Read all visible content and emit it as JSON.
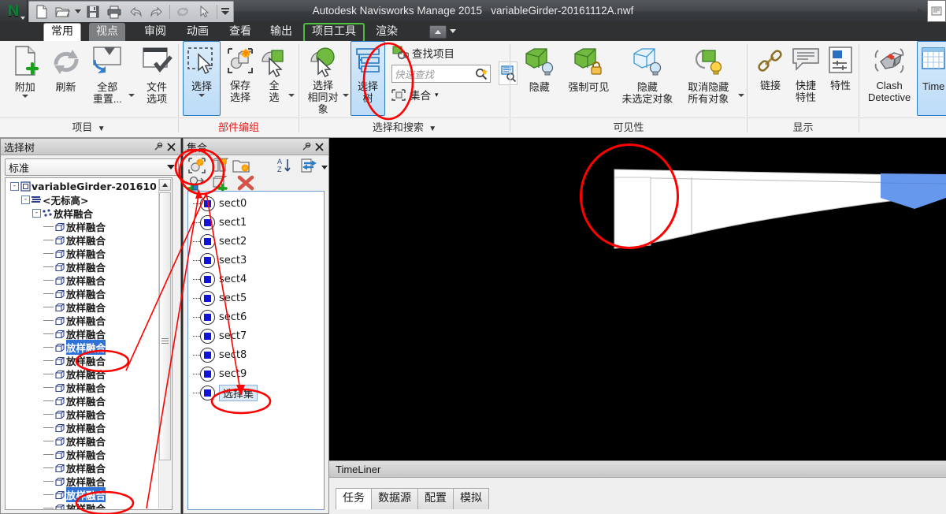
{
  "window": {
    "title_app": "Autodesk Navisworks Manage 2015",
    "title_file": "variableGirder-20161112A.nwf",
    "app_logo": "N"
  },
  "quick_access": [
    {
      "name": "new-file-icon",
      "label": "新建"
    },
    {
      "name": "open-file-icon",
      "label": "打开"
    },
    {
      "name": "open-dropdown-icon",
      "label": "▾"
    },
    {
      "name": "save-icon",
      "label": "保存"
    },
    {
      "name": "print-icon",
      "label": "打印"
    },
    {
      "name": "undo-icon",
      "label": "撤消"
    },
    {
      "name": "redo-icon",
      "label": "恢复"
    },
    {
      "name": "refresh-icon",
      "label": "刷新"
    },
    {
      "name": "select-cursor-icon",
      "label": "选择"
    },
    {
      "name": "qat-dropdown-icon",
      "label": "▾"
    }
  ],
  "tabs": [
    {
      "label": "常用",
      "state": "active"
    },
    {
      "label": "视点",
      "state": "hover"
    },
    {
      "label": "审阅",
      "state": "normal"
    },
    {
      "label": "动画",
      "state": "normal"
    },
    {
      "label": "查看",
      "state": "normal"
    },
    {
      "label": "输出",
      "state": "normal"
    },
    {
      "label": "项目工具",
      "state": "outlined"
    },
    {
      "label": "渲染",
      "state": "normal"
    }
  ],
  "ribbon": {
    "groups": [
      {
        "label": "项目",
        "label_color": "#333333",
        "buttons": [
          {
            "label": "附加",
            "icon": "attach-file-icon",
            "dropdown": true
          },
          {
            "label": "刷新",
            "icon": "refresh-icon",
            "dropdown": false
          },
          {
            "label": "全部\n重置...",
            "icon": "reset-all-icon",
            "dropdown": true
          },
          {
            "label": "文件\n选项",
            "icon": "file-options-icon",
            "dropdown": false
          }
        ]
      },
      {
        "label": "部件编组",
        "label_color": "#e11c1c",
        "buttons": [
          {
            "label": "选择",
            "icon": "select-marquee-icon",
            "dropdown": true,
            "selected": true
          },
          {
            "label": "保存\n选择",
            "icon": "save-selection-icon",
            "dropdown": false
          },
          {
            "label": "全\n选",
            "icon": "select-all-icon",
            "dropdown": true
          }
        ]
      },
      {
        "label": "选择和搜索",
        "label_color": "#333333",
        "buttons": [
          {
            "label": "选择\n相同对象",
            "icon": "select-same-icon",
            "dropdown": true
          },
          {
            "label": "选择\n树",
            "icon": "selection-tree-icon",
            "dropdown": false,
            "selected": true
          }
        ],
        "find_item_label": "查找项目",
        "find_item_icon": "find-item-icon",
        "quick_find_placeholder": "快速查找",
        "quick_find_icon": "search-icon",
        "sets_label": "集合",
        "sets_icon": "sets-icon",
        "sets_dropdown": "▾",
        "find_comments_icon": "find-comments-icon"
      },
      {
        "label": "可见性",
        "label_color": "#333333",
        "buttons": [
          {
            "label": "隐藏",
            "icon": "hide-icon",
            "dropdown": false
          },
          {
            "label": "强制可见",
            "icon": "require-visible-icon",
            "dropdown": false
          },
          {
            "label": "隐藏\n未选定对象",
            "icon": "hide-unselected-icon",
            "dropdown": false
          },
          {
            "label": "取消隐藏\n所有对象",
            "icon": "unhide-all-icon",
            "dropdown": true
          }
        ]
      },
      {
        "label": "显示",
        "label_color": "#333333",
        "buttons": [
          {
            "label": "链接",
            "icon": "links-icon",
            "dropdown": false
          },
          {
            "label": "快捷\n特性",
            "icon": "quick-properties-icon",
            "dropdown": false
          },
          {
            "label": "特性",
            "icon": "properties-icon",
            "dropdown": false
          }
        ]
      },
      {
        "label": "",
        "label_color": "#333333",
        "buttons": [
          {
            "label": "Clash\nDetective",
            "icon": "clash-detective-icon",
            "dropdown": false
          },
          {
            "label": "Time",
            "icon": "timeliner-icon",
            "dropdown": false,
            "selected": true
          }
        ]
      }
    ]
  },
  "selection_tree": {
    "title": "选择树",
    "pin_icon": "pin-icon",
    "close_icon": "close-icon",
    "dropdown_value": "标准",
    "dropdown_icon": "chevron-down-icon",
    "nodes": [
      {
        "label": "variableGirder-201610",
        "depth": 0,
        "icon": "file-node-icon",
        "expander": "-",
        "bold": true,
        "selected": false
      },
      {
        "label": "<无标高>",
        "depth": 1,
        "icon": "level-node-icon",
        "expander": "-",
        "bold": true,
        "selected": false
      },
      {
        "label": "放样融合",
        "depth": 2,
        "icon": "group-node-icon",
        "expander": "-",
        "bold": true,
        "selected": false
      },
      {
        "label": "放样融合",
        "depth": 3,
        "icon": "geometry-node-icon",
        "expander": "",
        "bold": true,
        "selected": false
      },
      {
        "label": "放样融合",
        "depth": 3,
        "icon": "geometry-node-icon",
        "expander": "",
        "bold": true,
        "selected": false
      },
      {
        "label": "放样融合",
        "depth": 3,
        "icon": "geometry-node-icon",
        "expander": "",
        "bold": true,
        "selected": false
      },
      {
        "label": "放样融合",
        "depth": 3,
        "icon": "geometry-node-icon",
        "expander": "",
        "bold": true,
        "selected": false
      },
      {
        "label": "放样融合",
        "depth": 3,
        "icon": "geometry-node-icon",
        "expander": "",
        "bold": true,
        "selected": false
      },
      {
        "label": "放样融合",
        "depth": 3,
        "icon": "geometry-node-icon",
        "expander": "",
        "bold": true,
        "selected": false
      },
      {
        "label": "放样融合",
        "depth": 3,
        "icon": "geometry-node-icon",
        "expander": "",
        "bold": true,
        "selected": false
      },
      {
        "label": "放样融合",
        "depth": 3,
        "icon": "geometry-node-icon",
        "expander": "",
        "bold": true,
        "selected": false
      },
      {
        "label": "放样融合",
        "depth": 3,
        "icon": "geometry-node-icon",
        "expander": "",
        "bold": true,
        "selected": false
      },
      {
        "label": "放样融合",
        "depth": 3,
        "icon": "geometry-node-icon",
        "expander": "",
        "bold": true,
        "selected": true
      },
      {
        "label": "放样融合",
        "depth": 3,
        "icon": "geometry-node-icon",
        "expander": "",
        "bold": true,
        "selected": false
      },
      {
        "label": "放样融合",
        "depth": 3,
        "icon": "geometry-node-icon",
        "expander": "",
        "bold": true,
        "selected": false
      },
      {
        "label": "放样融合",
        "depth": 3,
        "icon": "geometry-node-icon",
        "expander": "",
        "bold": true,
        "selected": false
      },
      {
        "label": "放样融合",
        "depth": 3,
        "icon": "geometry-node-icon",
        "expander": "",
        "bold": true,
        "selected": false
      },
      {
        "label": "放样融合",
        "depth": 3,
        "icon": "geometry-node-icon",
        "expander": "",
        "bold": true,
        "selected": false
      },
      {
        "label": "放样融合",
        "depth": 3,
        "icon": "geometry-node-icon",
        "expander": "",
        "bold": true,
        "selected": false
      },
      {
        "label": "放样融合",
        "depth": 3,
        "icon": "geometry-node-icon",
        "expander": "",
        "bold": true,
        "selected": false
      },
      {
        "label": "放样融合",
        "depth": 3,
        "icon": "geometry-node-icon",
        "expander": "",
        "bold": true,
        "selected": false
      },
      {
        "label": "放样融合",
        "depth": 3,
        "icon": "geometry-node-icon",
        "expander": "",
        "bold": true,
        "selected": false
      },
      {
        "label": "放样融合",
        "depth": 3,
        "icon": "geometry-node-icon",
        "expander": "",
        "bold": true,
        "selected": false
      },
      {
        "label": "放样融合",
        "depth": 3,
        "icon": "geometry-node-icon",
        "expander": "",
        "bold": true,
        "selected": true
      },
      {
        "label": "放样融合",
        "depth": 3,
        "icon": "geometry-node-icon",
        "expander": "",
        "bold": true,
        "selected": false
      }
    ]
  },
  "sets_panel": {
    "title": "集合",
    "pin_icon": "pin-icon",
    "close_icon": "close-icon",
    "toolbar_row1": [
      {
        "name": "save-search-icon"
      },
      {
        "name": "save-selection-set-icon"
      },
      {
        "name": "new-folder-icon"
      }
    ],
    "toolbar_right": [
      {
        "name": "sort-az-icon"
      },
      {
        "name": "import-export-icon"
      },
      {
        "name": "import-export-dropdown-icon"
      }
    ],
    "toolbar_row2": [
      {
        "name": "add-search-set-icon"
      },
      {
        "name": "add-selection-set-icon"
      },
      {
        "name": "delete-icon"
      }
    ],
    "items": [
      {
        "label": "sect0",
        "selected": false
      },
      {
        "label": "sect1",
        "selected": false
      },
      {
        "label": "sect2",
        "selected": false
      },
      {
        "label": "sect3",
        "selected": false
      },
      {
        "label": "sect4",
        "selected": false
      },
      {
        "label": "sect5",
        "selected": false
      },
      {
        "label": "sect6",
        "selected": false
      },
      {
        "label": "sect7",
        "selected": false
      },
      {
        "label": "sect8",
        "selected": false
      },
      {
        "label": "sect9",
        "selected": false
      },
      {
        "label": "选择集",
        "selected": true
      }
    ]
  },
  "timeliner": {
    "title": "TimeLiner",
    "tabs": [
      {
        "label": "任务",
        "active": true
      },
      {
        "label": "数据源",
        "active": false
      },
      {
        "label": "配置",
        "active": false
      },
      {
        "label": "模拟",
        "active": false
      }
    ]
  },
  "viewport": {
    "background": "#000000",
    "model_color": "#ffffff",
    "selected_color": "#6699ee",
    "annotation_color": "#ff0000"
  }
}
